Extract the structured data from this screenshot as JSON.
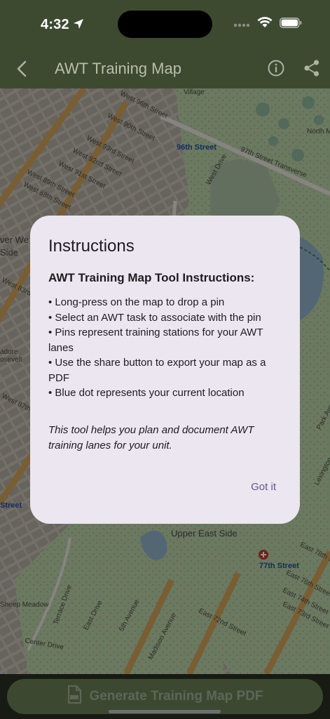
{
  "status_bar": {
    "time": "4:32",
    "icons": [
      "location-arrow-icon",
      "signal-dots-icon",
      "wifi-icon",
      "battery-icon"
    ]
  },
  "app_bar": {
    "title": "AWT Training Map",
    "icons": [
      "back-chevron-icon",
      "info-icon",
      "share-icon"
    ]
  },
  "map": {
    "labels": [
      "West 96th Street",
      "96th Street",
      "97th Street Transverse",
      "West Drive",
      "West 93rd Street",
      "West 92nd Street",
      "West 91st Street",
      "West 90th Street",
      "West 89th Street",
      "West 88th Street",
      "Upper East Side",
      "77th Street",
      "East 72nd Street",
      "5th Avenue",
      "Madison Avenue",
      "East Drive",
      "Center Drive",
      "Park Avenue",
      "Lexington",
      "Village",
      "North M",
      "Sheep Meadow",
      "Terrace Drive",
      "East 73rd Street",
      "East 74th Street",
      "East 76th Street",
      "East 78th Street",
      "Street",
      "Side",
      "ver We",
      "adore osevelt",
      "West 87th St",
      "West 83rd St"
    ]
  },
  "dialog": {
    "title": "Instructions",
    "heading": "AWT Training Map Tool Instructions:",
    "items": [
      "• Long-press on the map to drop a pin",
      "• Select an AWT task to associate with the pin",
      "• Pins represent training stations for your AWT lanes",
      "• Use the share button to export your map as a PDF",
      "• Blue dot represents your current location"
    ],
    "note": "This tool helps you plan and document AWT training lanes for your unit.",
    "button": "Got it"
  },
  "bottom_button": {
    "label": "Generate Training Map PDF",
    "icon": "pdf-file-icon"
  },
  "colors": {
    "app_bar": "#3d4a30",
    "dialog_bg": "#ece6f0",
    "dialog_button": "#65558f",
    "bottom_button": "#3c4930"
  }
}
